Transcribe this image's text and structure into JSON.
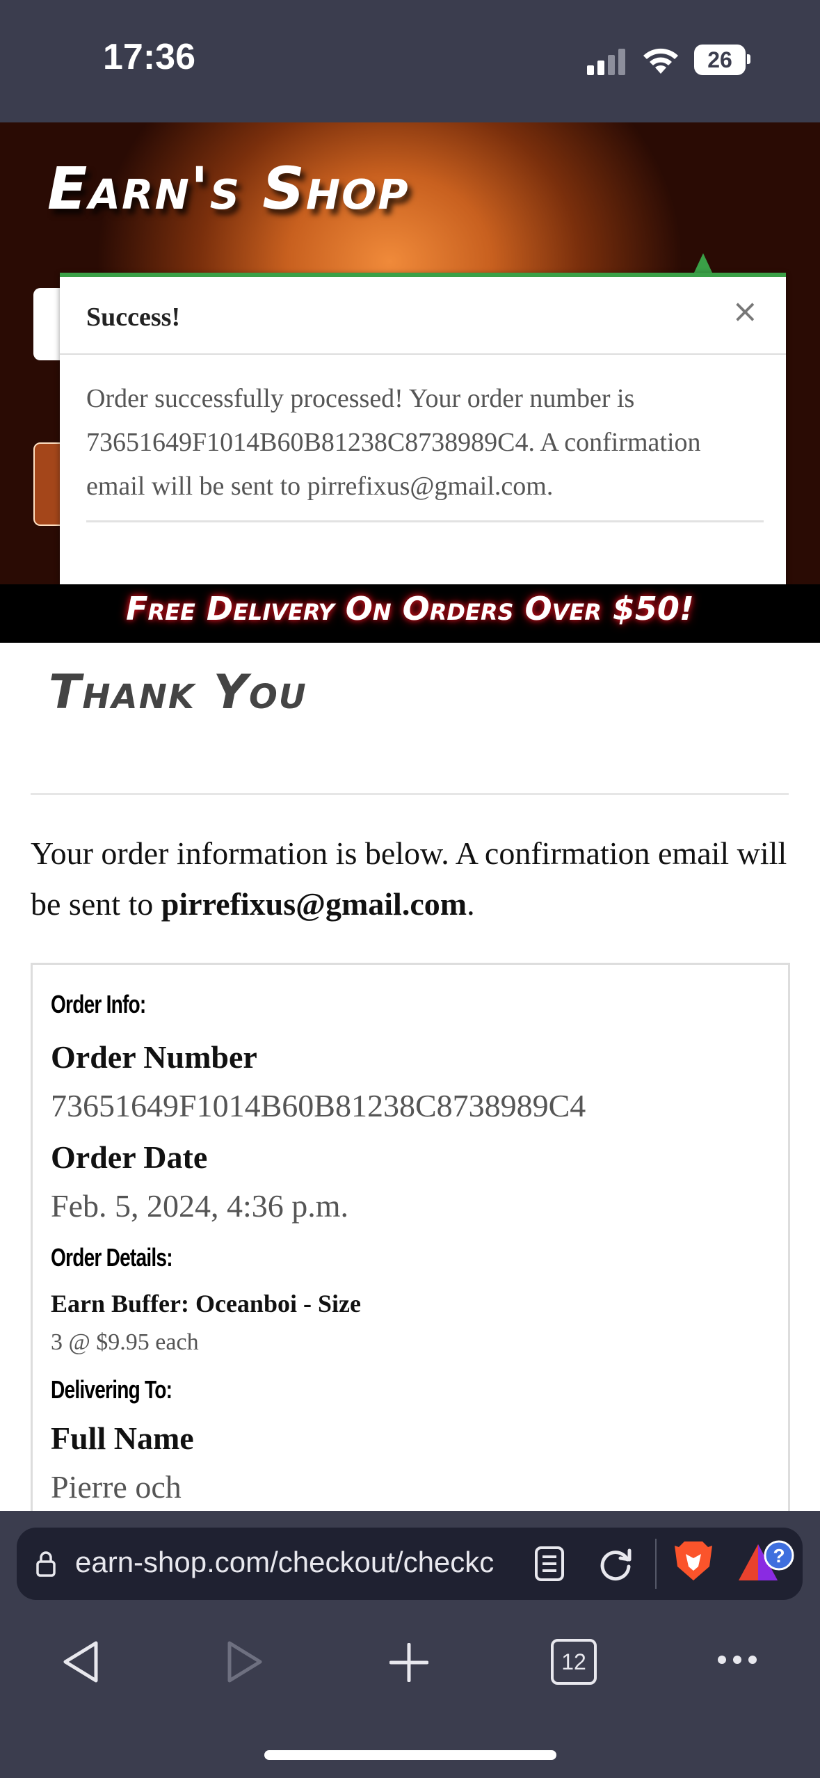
{
  "status_bar": {
    "time": "17:36",
    "battery": "26"
  },
  "header": {
    "logo": "Earn's Shop",
    "banner": "Free Delivery On Orders Over $50!"
  },
  "modal": {
    "title": "Success!",
    "close": "×",
    "body": "Order successfully processed! Your order number is 73651649F1014B60B81238C8738989C4. A confirmation email will be sent to pirrefixus@gmail.com."
  },
  "page": {
    "heading": "Thank You",
    "intro_text": "Your order information is below. A confirmation email will be sent to ",
    "intro_email": "pirrefixus@gmail.com",
    "intro_end": "."
  },
  "order": {
    "info_label": "Order Info:",
    "number_label": "Order Number",
    "number": "73651649F1014B60B81238C8738989C4",
    "date_label": "Order Date",
    "date": "Feb. 5, 2024, 4:36 p.m.",
    "details_label": "Order Details:",
    "item_name": "Earn Buffer: Oceanboi - Size",
    "item_qty": "3 @ $9.95 each",
    "delivering_label": "Delivering To:",
    "fullname_label": "Full Name",
    "fullname": "Pierre och"
  },
  "browser": {
    "url": "earn-shop.com/checkout/checkc",
    "tabs_count": "12"
  },
  "colors": {
    "success_green": "#3aa047",
    "header_orange": "#e67a2e",
    "chrome_bg": "#3b3d4e"
  }
}
